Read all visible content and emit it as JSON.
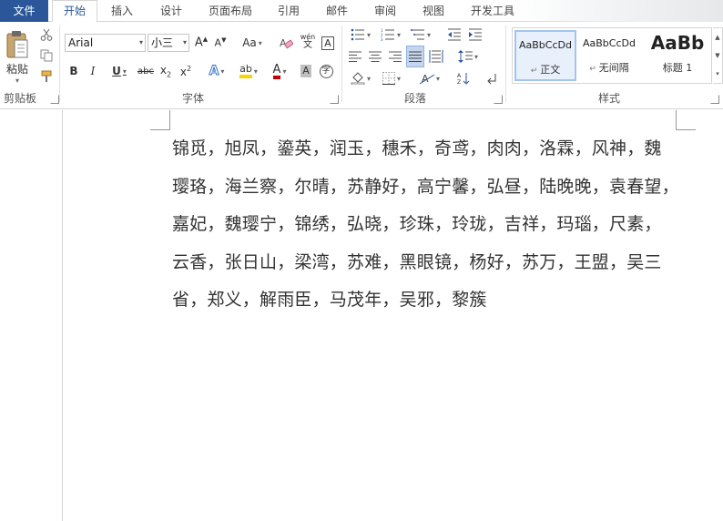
{
  "tabs": [
    "文件",
    "开始",
    "插入",
    "设计",
    "页面布局",
    "引用",
    "邮件",
    "审阅",
    "视图",
    "开发工具"
  ],
  "ribbon": {
    "clipboard": {
      "label": "剪贴板",
      "paste": "粘贴"
    },
    "font": {
      "label": "字体",
      "font_name": "Arial",
      "font_size": "小三",
      "change_case": "Aa",
      "phonetic": "wén"
    },
    "paragraph": {
      "label": "段落"
    },
    "styles": {
      "label": "样式",
      "items": [
        {
          "sample": "AaBbCcDd",
          "name": "正文"
        },
        {
          "sample": "AaBbCcDd",
          "name": "无间隔"
        },
        {
          "sample": "AaBb",
          "name": "标题 1"
        }
      ]
    }
  },
  "document": {
    "lines": [
      "锦觅，旭凤，鎏英，润玉，穗禾，奇鸢，肉肉，洛霖，风神，魏",
      "璎珞，海兰察，尔晴，苏静好，高宁馨，弘昼，陆晚晚，袁春望，",
      "嘉妃，魏璎宁，锦绣，弘晓，珍珠，玲珑，吉祥，玛瑙，尺素，",
      "云香，张日山，梁湾，苏难，黑眼镜，杨好，苏万，王盟，吴三",
      "省，郑义，解雨臣，马茂年，吴邪，黎簇"
    ]
  },
  "colors": {
    "file_tab": "#2b579a",
    "active_tab_text": "#2b579a",
    "font_color": "#c00000",
    "highlight": "#ffd200"
  }
}
